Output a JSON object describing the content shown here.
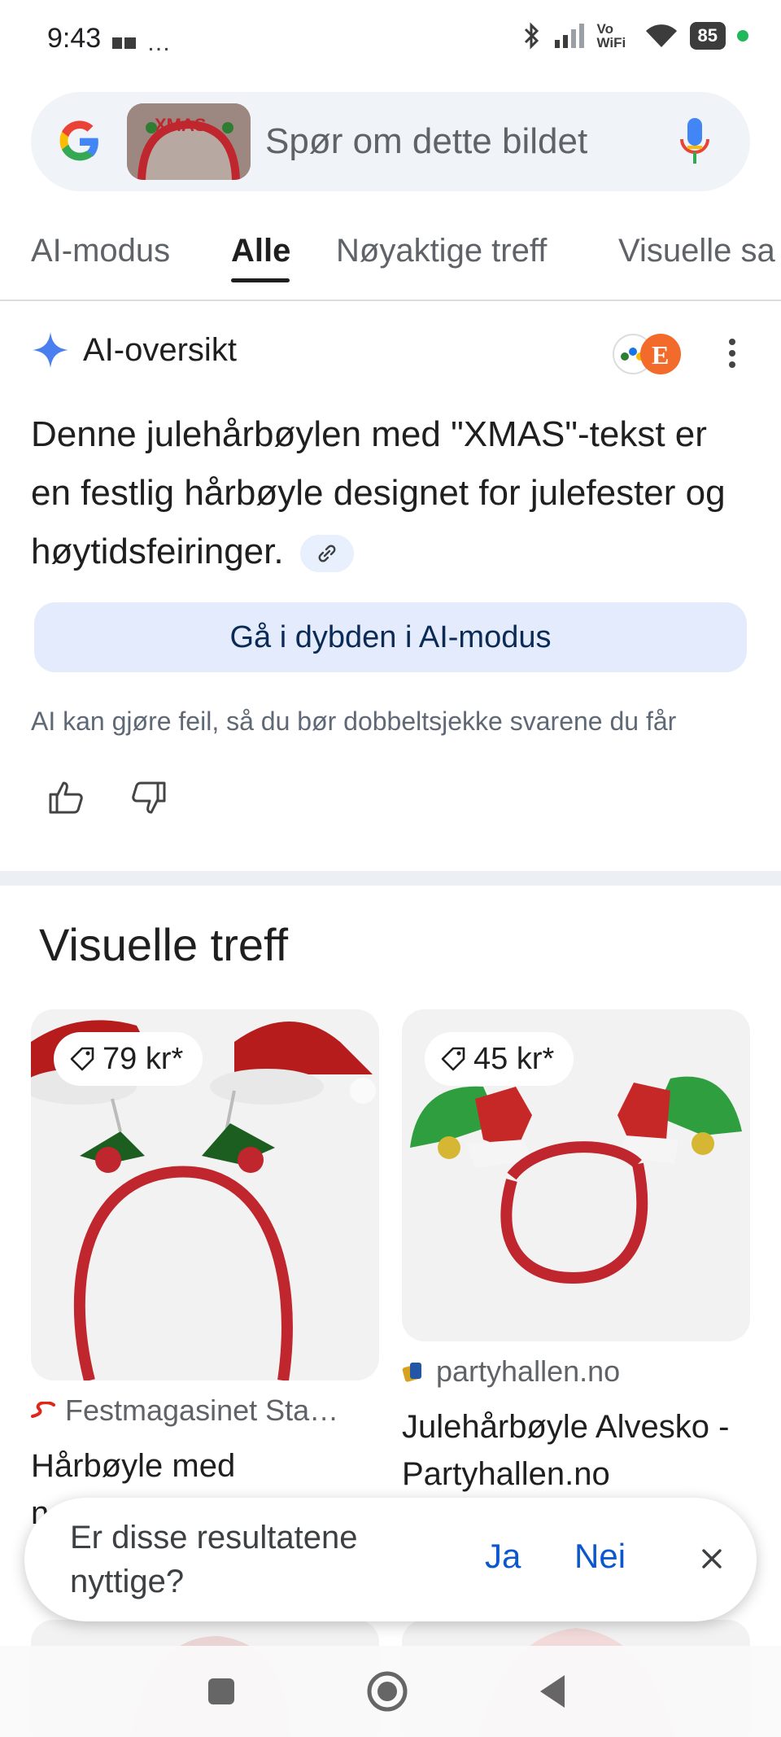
{
  "status_bar": {
    "time": "9:43",
    "dots": "…",
    "battery": "85",
    "vowifi": "Vo\nWiFi"
  },
  "search": {
    "placeholder": "Spør om dette bildet",
    "thumb_text": "XMAS"
  },
  "tabs": [
    {
      "label": "AI-modus",
      "active": false
    },
    {
      "label": "Alle",
      "active": true
    },
    {
      "label": "Nøyaktige treff",
      "active": false
    },
    {
      "label": "Visuelle sa",
      "active": false
    }
  ],
  "ai_overview": {
    "title": "AI-oversikt",
    "text": "Denne julehårbøylen med \"XMAS\"-tekst er en festlig hårbøyle designet for julefester og høytidsfeiringer.",
    "deep_button": "Gå i dybden i AI-modus",
    "disclaimer": "AI kan gjøre feil, så du bør dobbeltsjekke svarene du får",
    "source_letter": "E"
  },
  "visual_matches": {
    "title": "Visuelle treff",
    "cards": [
      {
        "price": "79 kr*",
        "source": "Festmagasinet Sta…",
        "title": "Hårbøyle med",
        "title_cut": "n"
      },
      {
        "price": "45 kr*",
        "source": "partyhallen.no",
        "title": "Julehårbøyle Alvesko - Partyhallen.no"
      }
    ]
  },
  "feedback": {
    "question": "Er disse resultatene nyttige?",
    "yes": "Ja",
    "no": "Nei"
  },
  "colors": {
    "accent": "#0b57d0",
    "chip_bg": "#e3ebfc",
    "headband_red": "#c0262d",
    "elf_green": "#2e9e3e"
  }
}
